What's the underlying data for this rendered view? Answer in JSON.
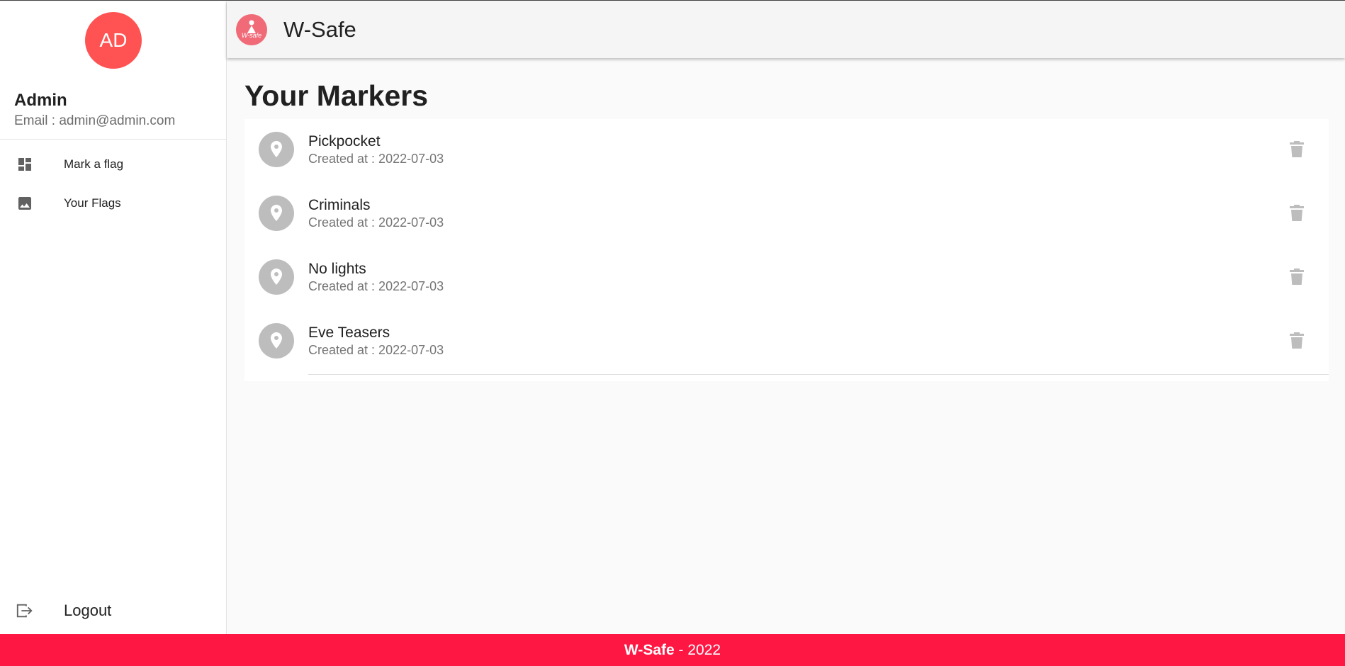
{
  "user": {
    "initials": "AD",
    "name": "Admin",
    "email": "Email : admin@admin.com"
  },
  "nav": {
    "items": [
      {
        "label": "Mark a flag",
        "icon": "dashboard-icon"
      },
      {
        "label": "Your Flags",
        "icon": "image-icon"
      }
    ],
    "logout_label": "Logout"
  },
  "header": {
    "logo_text": "W-safe",
    "title": "W-Safe"
  },
  "main": {
    "page_title": "Your Markers",
    "markers": [
      {
        "title": "Pickpocket",
        "subtitle": "Created at : 2022-07-03"
      },
      {
        "title": "Criminals",
        "subtitle": "Created at : 2022-07-03"
      },
      {
        "title": "No lights",
        "subtitle": "Created at : 2022-07-03"
      },
      {
        "title": "Eve Teasers",
        "subtitle": "Created at : 2022-07-03"
      }
    ]
  },
  "footer": {
    "brand": "W-Safe",
    "suffix": " - 2022"
  },
  "colors": {
    "accent": "#ff1744",
    "avatar": "#ff5252",
    "marker_icon_bg": "#bdbdbd"
  }
}
